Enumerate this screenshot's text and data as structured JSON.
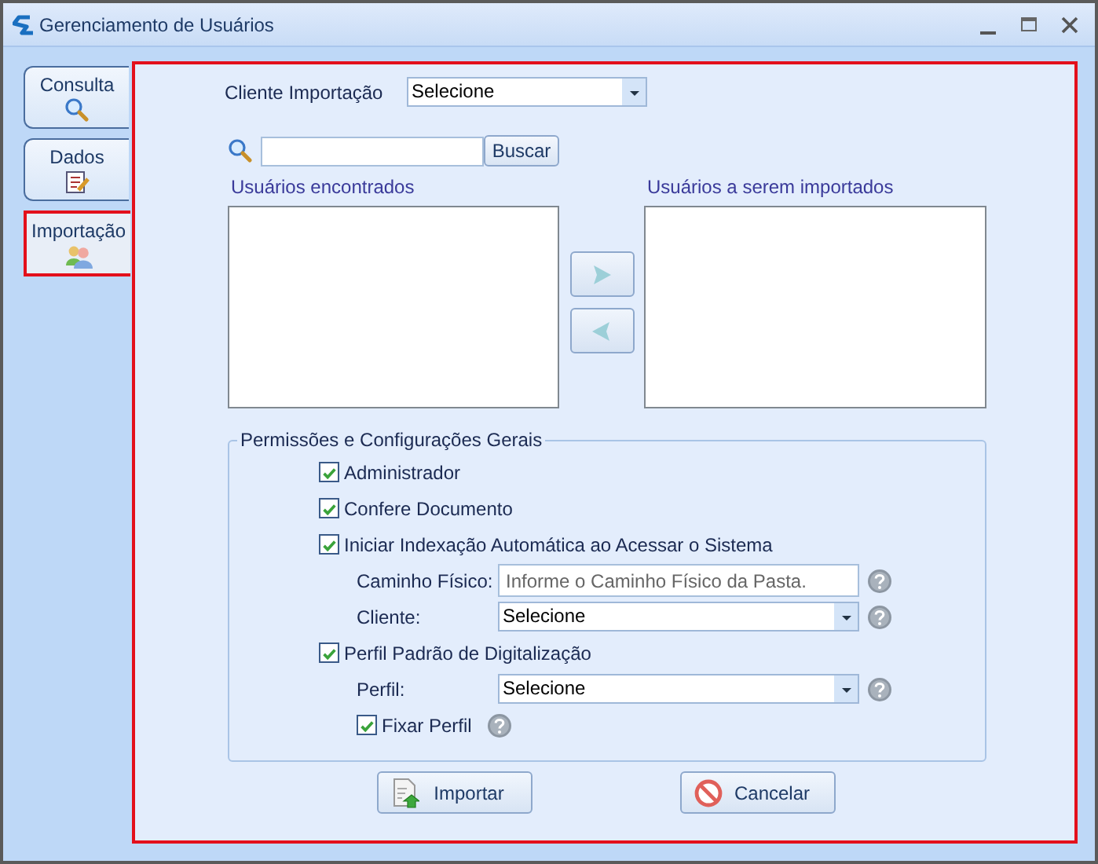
{
  "window": {
    "title": "Gerenciamento de Usuários"
  },
  "tabs": [
    {
      "label": "Consulta",
      "kind": "search",
      "selected": false
    },
    {
      "label": "Dados",
      "kind": "form",
      "selected": false
    },
    {
      "label": "Importação",
      "kind": "users",
      "selected": true
    }
  ],
  "cliente_importacao": {
    "label": "Cliente Importação",
    "value": "Selecione"
  },
  "search": {
    "button": "Buscar"
  },
  "found_users": {
    "label": "Usuários encontrados"
  },
  "users_to_import": {
    "label": "Usuários a serem importados"
  },
  "permissions": {
    "legend": "Permissões e Configurações Gerais",
    "items": [
      {
        "kind": "checkbox",
        "label": "Administrador",
        "checked": true
      },
      {
        "kind": "checkbox",
        "label": "Confere Documento",
        "checked": true
      },
      {
        "kind": "checkbox",
        "label": "Iniciar Indexação Automática ao Acessar o Sistema",
        "checked": true,
        "children": [
          {
            "kind": "field",
            "label": "Caminho Físico:",
            "placeholder": "Informe o Caminho Físico da Pasta."
          },
          {
            "kind": "select",
            "label": "Cliente:",
            "value": "Selecione"
          }
        ]
      },
      {
        "kind": "checkbox",
        "label": "Perfil Padrão de Digitalização",
        "checked": true,
        "children": [
          {
            "kind": "select",
            "label": "Perfil:",
            "value": "Selecione"
          },
          {
            "kind": "checkbox",
            "label": "Fixar Perfil",
            "checked": true
          }
        ]
      }
    ]
  },
  "buttons": [
    {
      "label": "Importar",
      "kind": "import"
    },
    {
      "label": "Cancelar",
      "kind": "cancel"
    }
  ]
}
